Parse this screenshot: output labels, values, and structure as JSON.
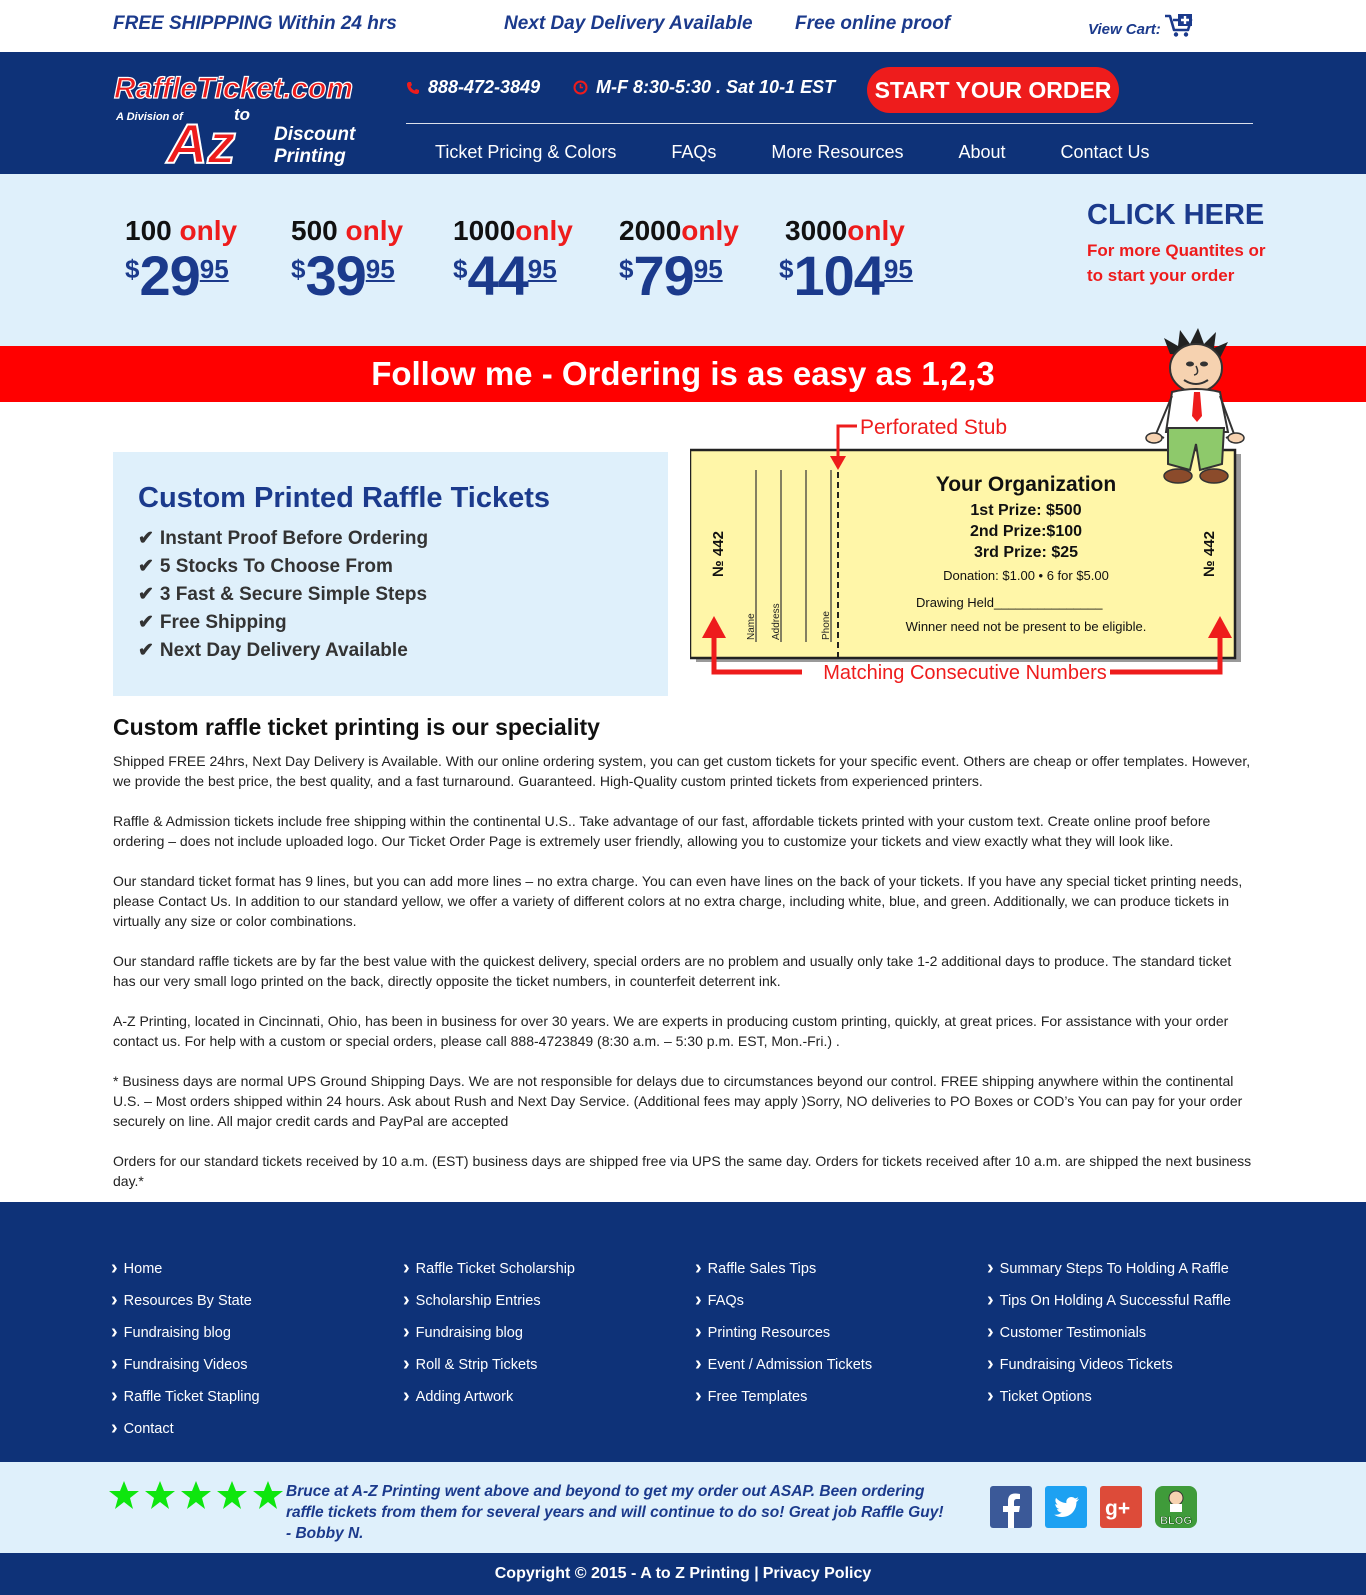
{
  "topbar": {
    "shipping": "FREE SHIPPPING Within 24 hrs",
    "delivery": "Next Day Delivery Available",
    "proof": "Free online proof",
    "cart_label": "View Cart:"
  },
  "header": {
    "logo_main": "RaffleTicket.com",
    "logo_division": "A Division of",
    "logo_az": "A to Z",
    "logo_discount": "Discount",
    "logo_printing": "Printing",
    "phone": "888-472-3849",
    "hours": "M-F 8:30-5:30 . Sat 10-1 EST",
    "start_button": "START YOUR ORDER",
    "nav": [
      "Ticket Pricing & Colors",
      "FAQs",
      "More Resources",
      "About",
      "Contact Us"
    ]
  },
  "pricing": {
    "items": [
      {
        "qty": "100",
        "only": " only",
        "dollars": "29",
        "cents": "95"
      },
      {
        "qty": "500",
        "only": " only",
        "dollars": "39",
        "cents": "95"
      },
      {
        "qty": "1000",
        "only": "only",
        "dollars": "44",
        "cents": "95"
      },
      {
        "qty": "2000",
        "only": "only",
        "dollars": "79",
        "cents": "95"
      },
      {
        "qty": "3000",
        "only": "only",
        "dollars": "104",
        "cents": "95"
      }
    ],
    "currency": "$",
    "click_here": "CLICK HERE",
    "click_sub": "For more Quantites or to start your order"
  },
  "banner": "Follow me - Ordering is as easy as 1,2,3",
  "features": {
    "title": "Custom Printed Raffle Tickets",
    "items": [
      "Instant Proof Before Ordering",
      "5 Stocks To Choose From",
      "3 Fast & Secure Simple Steps",
      "Free Shipping",
      "Next Day Delivery Available"
    ]
  },
  "ticket": {
    "perforated_label": "Perforated Stub",
    "matching_label": "Matching Consecutive Numbers",
    "number": "№ 442",
    "org": "Your Organization",
    "prize1": "1st Prize: $500",
    "prize2": "2nd Prize:$100",
    "prize3": "3rd Prize:   $25",
    "donation": "Donation: $1.00 • 6 for $5.00",
    "drawing": "Drawing Held_______________",
    "winner": "Winner need not be present to be eligible.",
    "stub_fields": [
      "Name",
      "Address",
      "Phone"
    ]
  },
  "content": {
    "heading": "Custom raffle ticket printing is our speciality",
    "paragraphs": [
      "Shipped FREE 24hrs, Next Day Delivery is Available. With our online ordering system, you can get custom tickets for your specific event. Others are cheap or offer templates. However, we provide the best price, the best quality, and a fast turnaround. Guaranteed. High-Quality custom printed tickets from experienced printers.",
      "Raffle & Admission tickets include free shipping within the continental U.S.. Take advantage of our fast, affordable tickets printed with your custom text. Create online proof before ordering – does not include uploaded logo. Our Ticket Order Page is extremely user friendly, allowing you to customize your tickets and view exactly what they will look like.",
      "Our standard ticket format has 9 lines, but you can add more lines – no extra charge. You can even have lines on the back of your tickets. If you have any special ticket printing needs, please Contact Us. In addition to our standard yellow, we offer a variety of different colors at no extra charge, including white, blue, and green. Additionally, we can produce tickets in virtually any size or color combinations.",
      "Our standard raffle tickets are by far the best value with the quickest delivery, special orders are no problem and usually only take 1-2 additional days to produce. The standard ticket has our very small logo printed on the back, directly opposite the ticket numbers, in counterfeit deterrent ink.",
      "A-Z Printing, located in Cincinnati, Ohio, has been in business for over 30 years. We are experts in producing custom printing, quickly, at great prices. For assistance with your order contact us. For help with a custom or special orders, please call 888-4723849 (8:30 a.m. – 5:30 p.m. EST, Mon.-Fri.) .",
      "* Business days are normal UPS Ground Shipping Days. We are not responsible for delays due to circumstances beyond our control. FREE shipping anywhere within the continental U.S. – Most orders shipped within 24 hours. Ask about Rush and Next Day Service. (Additional fees may apply )Sorry, NO deliveries to PO Boxes or COD’s You can pay for your order securely on line. All major credit cards and PayPal are accepted",
      "Orders for our standard tickets received by 10 a.m. (EST) business days are shipped free via UPS the same day. Orders for tickets received after 10 a.m. are shipped the next business day.*"
    ]
  },
  "footer": {
    "col1": [
      "Home",
      "Resources By State",
      "Fundraising blog",
      "Fundraising Videos",
      "Raffle Ticket Stapling",
      "Contact"
    ],
    "col2": [
      "Raffle Ticket Scholarship",
      "Scholarship Entries",
      "Fundraising blog",
      "Roll & Strip Tickets",
      "Adding Artwork"
    ],
    "col3": [
      "Raffle Sales Tips",
      "FAQs",
      "Printing Resources",
      "Event / Admission Tickets",
      "Free Templates"
    ],
    "col4": [
      "Summary Steps To Holding A Raffle",
      "Tips On Holding A Successful Raffle",
      "Customer Testimonials",
      "Fundraising Videos Tickets",
      "Ticket Options"
    ]
  },
  "testimonial": {
    "rating": 5,
    "quote": "Bruce at A-Z Printing went above and beyond to get my order out ASAP. Been ordering raffle tickets from them for several years and will continue to do so! Great job Raffle Guy! - Bobby N.",
    "blog_label": "BLOG"
  },
  "copyright": {
    "text": "Copyright © 2015 - A to Z Printing | ",
    "privacy": "Privacy Policy"
  },
  "colors": {
    "navy": "#0e3278",
    "brand_blue": "#1b3a8c",
    "red": "#ee1c1c",
    "light_blue": "#dff0fb",
    "ticket_yellow": "#fff6a8",
    "star_green": "#0ee60e"
  }
}
